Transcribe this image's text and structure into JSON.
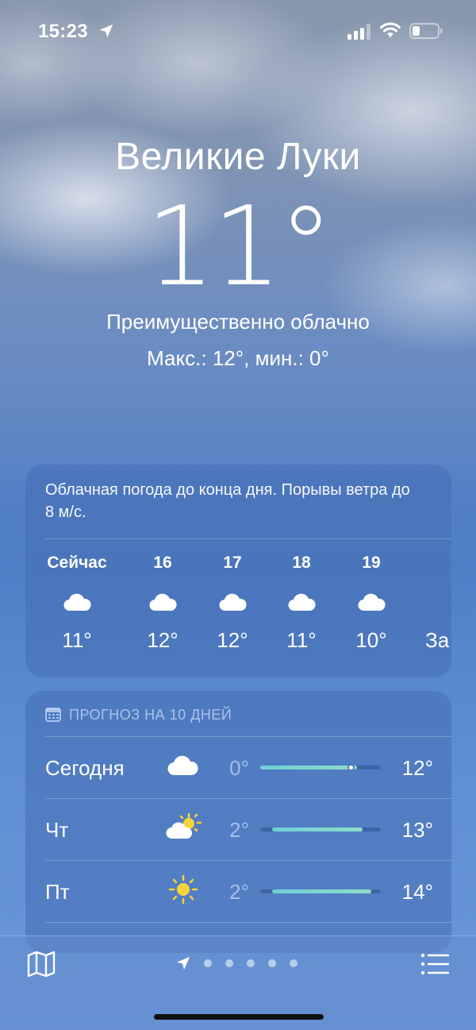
{
  "status_bar": {
    "time": "15:23"
  },
  "location": {
    "city": "Великие Луки",
    "temperature": "11°",
    "condition": "Преимущественно облачно",
    "hi_lo": "Макс.: 12°, мин.: 0°"
  },
  "hourly": {
    "summary": "Облачная погода до конца дня. Порывы ветра до 8 м/с.",
    "items": [
      {
        "label": "Сейчас",
        "icon": "cloud-icon",
        "temp": "11°"
      },
      {
        "label": "16",
        "icon": "cloud-icon",
        "temp": "12°"
      },
      {
        "label": "17",
        "icon": "cloud-icon",
        "temp": "12°"
      },
      {
        "label": "18",
        "icon": "cloud-icon",
        "temp": "11°"
      },
      {
        "label": "19",
        "icon": "cloud-icon",
        "temp": "10°"
      },
      {
        "label": "",
        "icon": "",
        "temp": "За"
      }
    ]
  },
  "daily": {
    "header": "ПРОГНОЗ НА 10 ДНЕЙ",
    "rows": [
      {
        "day": "Сегодня",
        "icon": "cloud-icon",
        "low": "0°",
        "high": "12°",
        "range_start": 0.0,
        "range_end": 0.8,
        "current": 0.75
      },
      {
        "day": "Чт",
        "icon": "partly-sunny-icon",
        "low": "2°",
        "high": "13°",
        "range_start": 0.1,
        "range_end": 0.85
      },
      {
        "day": "Пт",
        "icon": "sun-icon",
        "low": "2°",
        "high": "14°",
        "range_start": 0.1,
        "range_end": 0.92
      }
    ]
  },
  "bottom_bar": {
    "pages": 5,
    "current_page": 0
  },
  "colors": {
    "bar_gradient_start": "#6fd0d8",
    "bar_gradient_end": "#8ddcc8",
    "sun": "#f7d33a"
  }
}
